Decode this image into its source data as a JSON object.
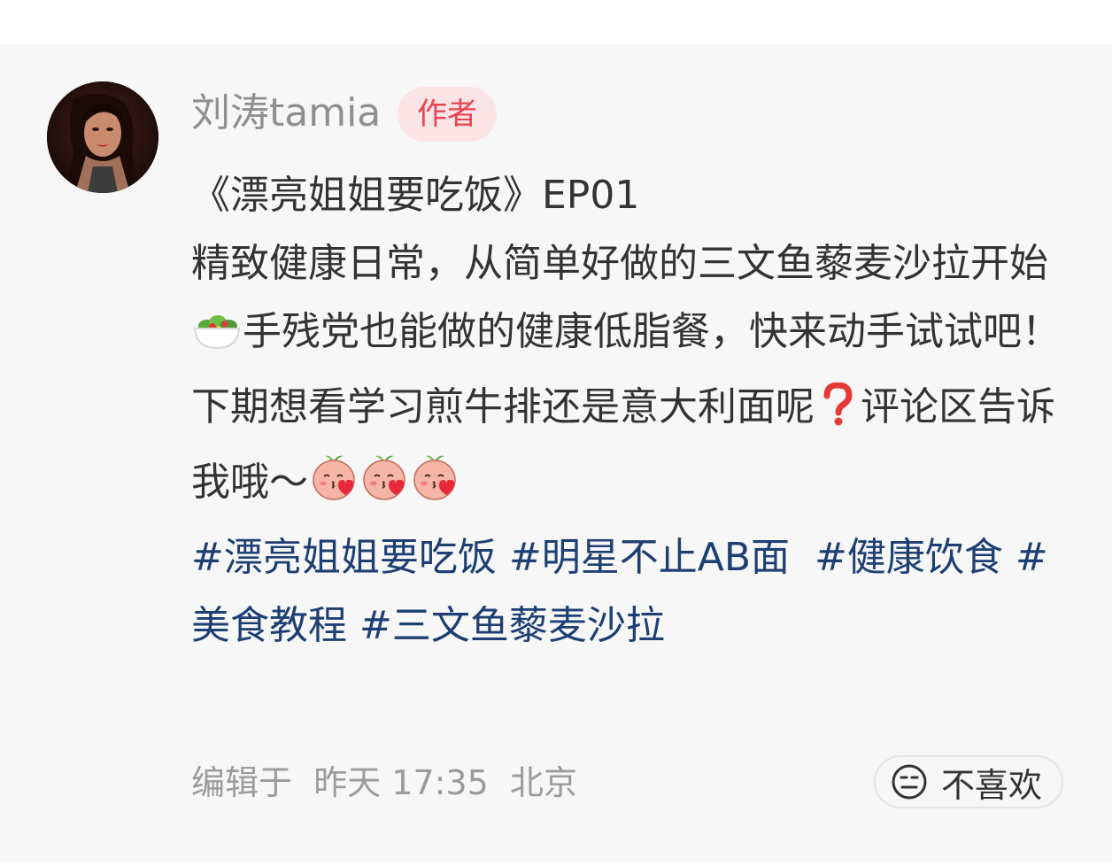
{
  "post": {
    "author": {
      "name": "刘涛tamia",
      "badge": "作者"
    },
    "title_line": "《漂亮姐姐要吃饭》EP01",
    "body_1": "精致健康日常，从简单好做的三文鱼藜麦沙拉开始",
    "body_2": "手残党也能做的健康低脂餐，快来动手试试吧！",
    "body_3": "下期想看学习煎牛排还是意大利面呢",
    "body_4": "评论区告诉我哦～",
    "tags": [
      "#漂亮姐姐要吃饭",
      "#明星不止AB面",
      "#健康饮食",
      "#美食教程",
      "#三文鱼藜麦沙拉"
    ],
    "meta": {
      "edited_label": "编辑于",
      "time": "昨天 17:35",
      "location": "北京"
    },
    "dislike_label": "不喜欢"
  },
  "icons": {
    "salad": "salad-bowl-icon",
    "question": "red-question-mark-icon",
    "sticker": "peach-kiss-sticker-icon",
    "dislike": "meh-face-icon"
  },
  "colors": {
    "tag": "#1e3f73",
    "badge_text": "#e8434f",
    "badge_bg": "#fbe4e6"
  }
}
